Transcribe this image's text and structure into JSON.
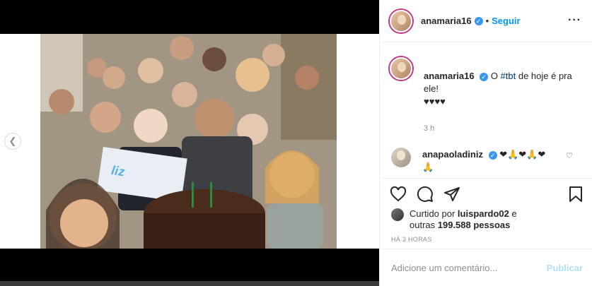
{
  "post": {
    "author": "anamaria16",
    "follow_label": "Seguir",
    "bullet": "•",
    "caption_author": "anamaria16",
    "caption_prefix": "O ",
    "caption_hashtag": "#tbt",
    "caption_suffix": " de hoje é pra ele!",
    "caption_hearts": "♥♥♥♥",
    "caption_time": "3 h",
    "comment": {
      "author": "anapaoladiniz",
      "emojis": "❤🙏❤🙏❤🙏"
    },
    "likes": {
      "liked_by_prefix": "Curtido por ",
      "liked_by_user": "luispardo02",
      "liked_by_middle": " e outras ",
      "likes_count": "199.588",
      "likes_suffix": " pessoas"
    },
    "timestamp": "HÁ 3 HORAS",
    "comment_placeholder": "Adicione um comentário...",
    "publish_label": "Publicar"
  },
  "colors": {
    "accent": "#0095f6",
    "verified": "#3897f0",
    "publish_disabled": "#b2dffc"
  },
  "carousel": {
    "slides": 2,
    "active_slide": 1
  },
  "icons": [
    "chevron-left-icon",
    "more-icon",
    "verified-icon",
    "heart-icon",
    "comment-icon",
    "share-icon",
    "bookmark-icon",
    "small-heart-icon"
  ]
}
